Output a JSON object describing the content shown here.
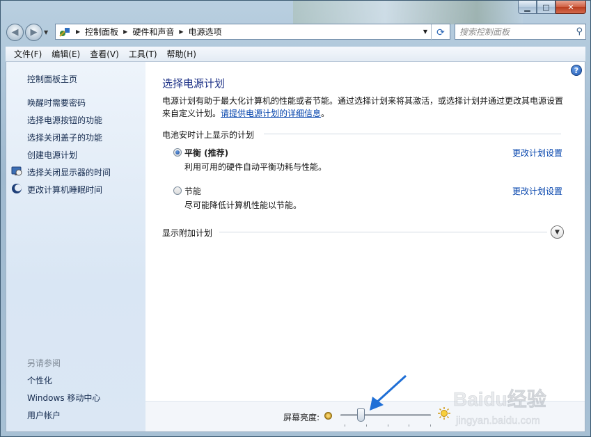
{
  "window": {
    "caption_minimize": "▁",
    "caption_maximize": "□",
    "caption_close": "✕"
  },
  "address_bar": {
    "crumbs": [
      "控制面板",
      "硬件和声音",
      "电源选项"
    ],
    "search_placeholder": "搜索控制面板"
  },
  "menu": [
    "文件(F)",
    "编辑(E)",
    "查看(V)",
    "工具(T)",
    "帮助(H)"
  ],
  "sidebar": {
    "home": "控制面板主页",
    "links": [
      "唤醒时需要密码",
      "选择电源按钮的功能",
      "选择关闭盖子的功能",
      "创建电源计划",
      "选择关闭显示器的时间",
      "更改计算机睡眠时间"
    ],
    "see_also_title": "另请参阅",
    "see_also": [
      "个性化",
      "Windows 移动中心",
      "用户帐户"
    ]
  },
  "main": {
    "help": "?",
    "title": "选择电源计划",
    "description_line1": "电源计划有助于最大化计算机的性能或者节能。通过选择计划来将其激活，或选择计划并通过更改其电源设置",
    "description_line2_prefix": "来自定义计划。",
    "description_link": "请提供电源计划的详细信息",
    "description_suffix": "。",
    "group_title": "电池安时计上显示的计划",
    "plans": [
      {
        "name": "平衡 (推荐)",
        "desc": "利用可用的硬件自动平衡功耗与性能。",
        "selected": true,
        "link": "更改计划设置"
      },
      {
        "name": "节能",
        "desc": "尽可能降低计算机性能以节能。",
        "selected": false,
        "link": "更改计划设置"
      }
    ],
    "show_more": "显示附加计划",
    "expander_icon": "chevron-down-icon"
  },
  "brightness": {
    "label": "屏幕亮度:",
    "level_percent": 22
  },
  "watermark": {
    "brand": "Baidu经验",
    "url": "jingyan.baidu.com"
  },
  "colors": {
    "title_blue": "#1e3287",
    "link_blue": "#0645ad",
    "arrow_blue": "#1f6fd6"
  }
}
